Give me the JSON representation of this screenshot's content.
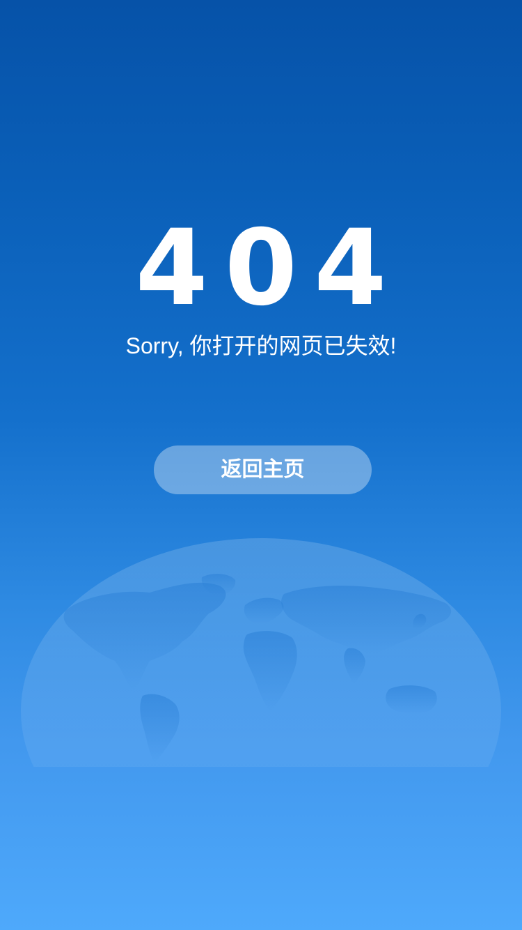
{
  "error": {
    "code": "404",
    "message": "Sorry, 你打开的网页已失效!"
  },
  "actions": {
    "home_label": "返回主页"
  },
  "colors": {
    "background_top": "#0652a8",
    "background_bottom": "#4ea9fb",
    "text": "#ffffff"
  },
  "icons": {
    "background": "globe-world-map-icon"
  }
}
